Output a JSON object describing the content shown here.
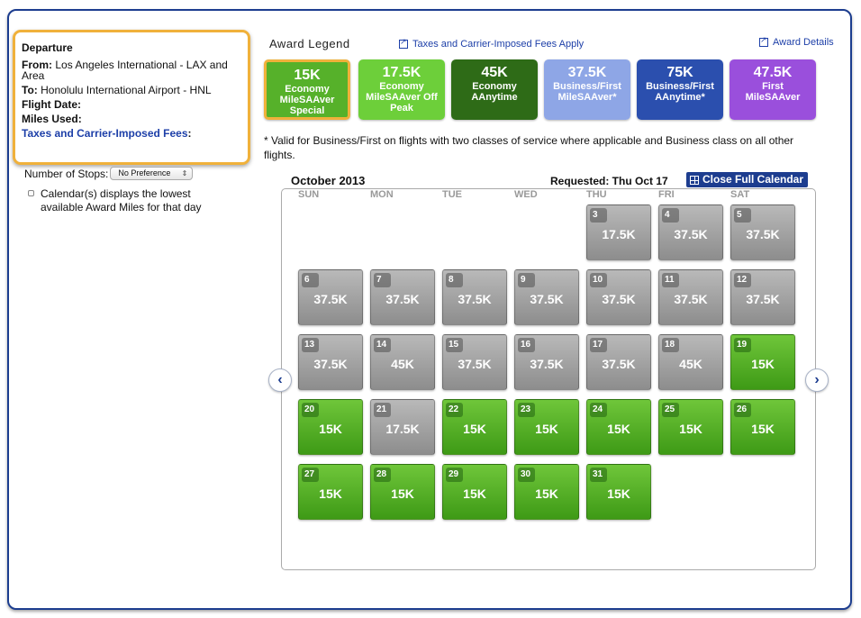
{
  "summary": {
    "title": "Departure",
    "from_label": "From:",
    "from_value": "Los Angeles International - LAX and Area",
    "to_label": "To:",
    "to_value": "Honolulu International Airport - HNL",
    "flight_date_label": "Flight Date:",
    "miles_used_label": "Miles Used:",
    "fees_label": "Taxes and Carrier-Imposed Fees",
    "fees_colon": ":"
  },
  "stops": {
    "label": "Number of Stops:",
    "selected": "No Preference"
  },
  "calendar_option": "Calendar(s) displays the lowest available Award Miles for that day",
  "legend": {
    "title": "Award Legend",
    "fees_link": "Taxes and Carrier-Imposed Fees Apply",
    "details_link": "Award Details",
    "items": [
      {
        "miles": "15K",
        "line1": "Economy",
        "line2": "MileSAAver",
        "line3": "Special",
        "color": "#56b12a",
        "selected": true
      },
      {
        "miles": "17.5K",
        "line1": "Economy",
        "line2": "MileSAAver Off",
        "line3": "Peak",
        "color": "#6dcf3a"
      },
      {
        "miles": "45K",
        "line1": "Economy",
        "line2": "AAnytime",
        "line3": "",
        "color": "#2e6b17"
      },
      {
        "miles": "37.5K",
        "line1": "Business/First",
        "line2": "MileSAAver*",
        "line3": "",
        "color": "#8ea6e6"
      },
      {
        "miles": "75K",
        "line1": "Business/First",
        "line2": "AAnytime*",
        "line3": "",
        "color": "#2b4fae"
      },
      {
        "miles": "47.5K",
        "line1": "First",
        "line2": "MileSAAver",
        "line3": "",
        "color": "#9a4fdc"
      }
    ]
  },
  "note": "* Valid for Business/First on flights with two classes of service where applicable and Business class on all other flights.",
  "calendar": {
    "month": "October 2013",
    "requested": "Requested: Thu Oct 17",
    "close_label": "Close Full Calendar",
    "prev_icon": "‹",
    "next_icon": "›",
    "weekdays": [
      "SUN",
      "MON",
      "TUE",
      "WED",
      "THU",
      "FRI",
      "SAT"
    ],
    "days": [
      {
        "day": "3",
        "miles": "17.5K",
        "status": "gray"
      },
      {
        "day": "4",
        "miles": "37.5K",
        "status": "gray"
      },
      {
        "day": "5",
        "miles": "37.5K",
        "status": "gray"
      },
      {
        "day": "6",
        "miles": "37.5K",
        "status": "gray"
      },
      {
        "day": "7",
        "miles": "37.5K",
        "status": "gray"
      },
      {
        "day": "8",
        "miles": "37.5K",
        "status": "gray"
      },
      {
        "day": "9",
        "miles": "37.5K",
        "status": "gray"
      },
      {
        "day": "10",
        "miles": "37.5K",
        "status": "gray"
      },
      {
        "day": "11",
        "miles": "37.5K",
        "status": "gray"
      },
      {
        "day": "12",
        "miles": "37.5K",
        "status": "gray"
      },
      {
        "day": "13",
        "miles": "37.5K",
        "status": "gray"
      },
      {
        "day": "14",
        "miles": "45K",
        "status": "gray"
      },
      {
        "day": "15",
        "miles": "37.5K",
        "status": "gray"
      },
      {
        "day": "16",
        "miles": "37.5K",
        "status": "gray"
      },
      {
        "day": "17",
        "miles": "37.5K",
        "status": "gray"
      },
      {
        "day": "18",
        "miles": "45K",
        "status": "gray"
      },
      {
        "day": "19",
        "miles": "15K",
        "status": "green"
      },
      {
        "day": "20",
        "miles": "15K",
        "status": "green"
      },
      {
        "day": "21",
        "miles": "17.5K",
        "status": "gray"
      },
      {
        "day": "22",
        "miles": "15K",
        "status": "green"
      },
      {
        "day": "23",
        "miles": "15K",
        "status": "green"
      },
      {
        "day": "24",
        "miles": "15K",
        "status": "green"
      },
      {
        "day": "25",
        "miles": "15K",
        "status": "green"
      },
      {
        "day": "26",
        "miles": "15K",
        "status": "green"
      },
      {
        "day": "27",
        "miles": "15K",
        "status": "green"
      },
      {
        "day": "28",
        "miles": "15K",
        "status": "green"
      },
      {
        "day": "29",
        "miles": "15K",
        "status": "green"
      },
      {
        "day": "30",
        "miles": "15K",
        "status": "green"
      },
      {
        "day": "31",
        "miles": "15K",
        "status": "green"
      }
    ]
  }
}
